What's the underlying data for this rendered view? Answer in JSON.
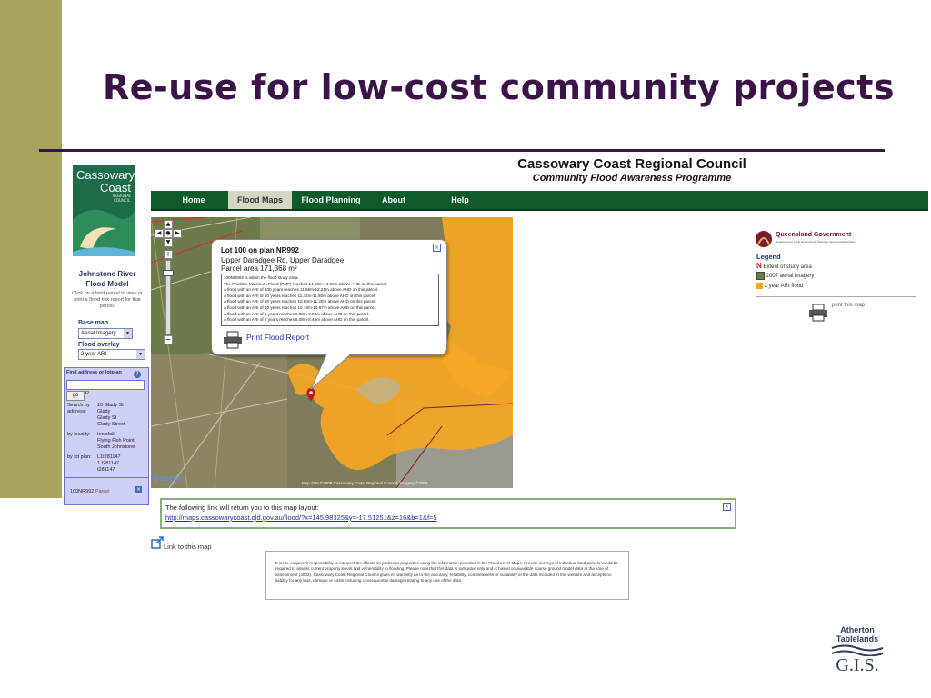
{
  "slide": {
    "title": "Re-use for low-cost community projects"
  },
  "site": {
    "title": "Cassowary Coast Regional Council",
    "subtitle": "Community Flood Awareness Programme",
    "nav": [
      "Home",
      "Flood Maps",
      "Flood Planning",
      "About",
      "Help"
    ],
    "active_nav": "Flood Maps"
  },
  "logo": {
    "line1": "Cassowary",
    "line2": "Coast",
    "line3": "REGIONAL COUNCIL"
  },
  "left_panel": {
    "model_title_1": "Johnstone River",
    "model_title_2": "Flood Model",
    "help_text": "Click on a land parcel to view or print a flood risk report for that parcel.",
    "base_map_label": "Base map",
    "base_map_value": "Aerial Imagery",
    "flood_overlay_label": "Flood overlay",
    "flood_overlay_value": "2 year ARI",
    "find_label": "Find address or lotplan",
    "find_value": "100nr992",
    "go_label": "go",
    "search_by_address_label": "Search by address:",
    "search_by_address_examples": [
      "10 Glady St",
      "Glady",
      "Glady St",
      "Glady Street"
    ],
    "by_locality_label": "by locality:",
    "by_locality_examples": [
      "Innisfail",
      "Flying Fish Point",
      "South Johnstone"
    ],
    "by_lot_plan_label": "by lot plan:",
    "by_lot_plan_examples": [
      "L1t281147",
      "1 t281147",
      "t281147"
    ],
    "result_text": "100NR992",
    "result_type": "Parcel"
  },
  "popup": {
    "title": "Lot 100 on plan NR992",
    "address": "Upper Daradgee Rd, Upper Daradgee",
    "area": "Parcel area 171,368 m²",
    "details": [
      "100NR992 is within the flood study area.",
      "The Possible Maximum Flood (PMF) reaches 14.56m-14.86m above AHD on this parcel.",
      "A flood with an ARI of 100 years reaches 11.86m-12.21m above AHD on this parcel.",
      "A flood with an ARI of 50 years reaches 11.43m-11.80m above AHD on this parcel.",
      "A flood with an ARI of 20 years reaches 10.80m-11.20m above AHD on this parcel.",
      "A flood with an ARI of 10 years reaches 10.19m-10.57m above AHD on this parcel.",
      "A flood with an ARI of 5 years reaches 9.63m-9.99m above AHD on this parcel.",
      "A flood with an ARI of 2 years reaches 8.08m-8.48m above AHD on this parcel."
    ],
    "report_link": "Print Flood Report"
  },
  "map": {
    "attribution": "Map data ©2008 Cassowary Coast Regional Council, Imagery ©2008",
    "google": "Google"
  },
  "url_box": {
    "text": "The following link will return you to this map layout:",
    "link": "http://maps.cassowarycoast.qld.gov.au/flood/?x=145.98325&y=-17.51251&z=16&b=1&f=5"
  },
  "link_to_map": "Link to this map",
  "disclaimer": "It is the enquirer's responsibility to interpret the effects on particular properties using the information provided in the Flood Level Maps. Precise surveys of individual land parcels would be required to assess current property levels and vulnerability to flooding. Please note that this data is indicative only and is based on available coarse ground model data at the time of assessment (2002). Cassowary Coast Regional Council gives no warranty as to the accuracy, reliability, completeness or suitability of the data included in this website and accepts no liability for any loss, damage or costs including consequential damage relating to any use of the data.",
  "right_panel": {
    "gov_logo": "Queensland Government",
    "gov_dept": "Department of Local Government, Planning, Sport and Recreation",
    "legend_title": "Legend",
    "legend_items": [
      "Extent of study area",
      "2007 aerial imagery",
      "2 year ARI flood"
    ],
    "print_map": "print this map"
  },
  "footer_logo": {
    "line1": "Atherton",
    "line2": "Tablelands",
    "line3": "G.I.S."
  },
  "colors": {
    "accent_bar": "#a9a45d",
    "title": "#3a1446",
    "nav": "#0d5a2a",
    "flood": "#f5a623",
    "link": "#2233aa"
  }
}
